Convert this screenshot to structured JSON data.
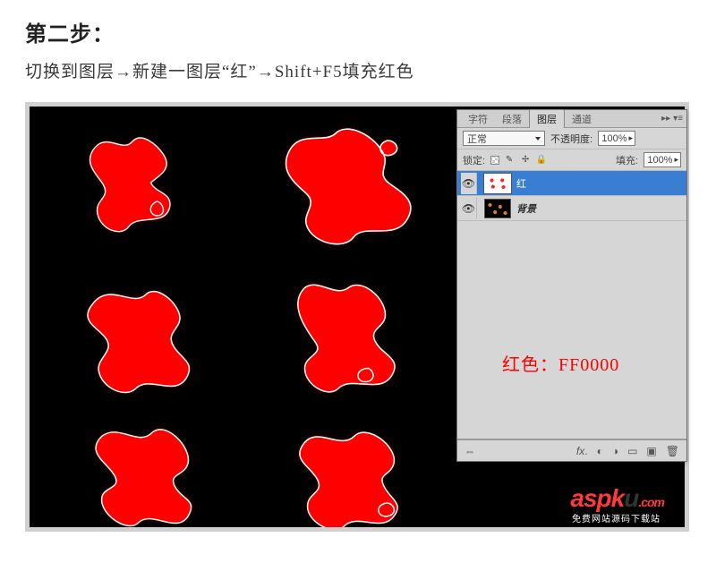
{
  "heading": "第二步：",
  "instruction": "切换到图层→新建一图层“红”→Shift+F5填充红色",
  "panel": {
    "tabs": [
      "字符",
      "段落",
      "图层",
      "通道"
    ],
    "active_tab_index": 2,
    "blend_mode": "正常",
    "opacity_label": "不透明度:",
    "opacity_value": "100%",
    "lock_label": "锁定:",
    "fill_label": "填充:",
    "fill_value": "100%",
    "layers": [
      {
        "name": "红",
        "selected": true
      },
      {
        "name": "背景",
        "selected": false
      }
    ]
  },
  "annotation": "红色：FF0000",
  "watermark": {
    "brand_red": "aspk",
    "brand_dark": "u",
    "tld": ".com",
    "sub": "免费网站源码下载站"
  }
}
